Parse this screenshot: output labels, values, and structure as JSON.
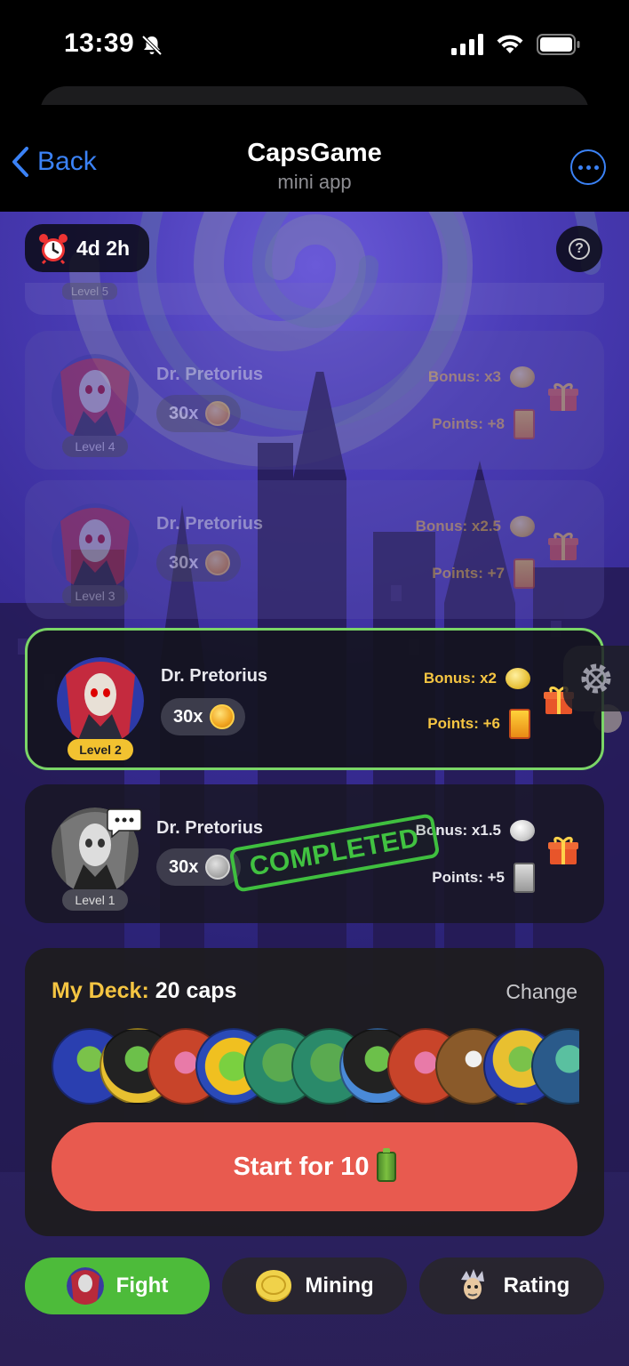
{
  "status": {
    "time": "13:39"
  },
  "nav": {
    "back_label": "Back",
    "title": "CapsGame",
    "subtitle": "mini app"
  },
  "timer": {
    "icon": "alarm-clock-icon",
    "value": "4d 2h"
  },
  "top_strip": {
    "label": "Level 5"
  },
  "bosses": [
    {
      "name": "Dr. Pretorius",
      "multiplier": "30x",
      "level": "Level 4",
      "bonus": "Bonus: x3",
      "points": "Points: +8",
      "state": "locked"
    },
    {
      "name": "Dr. Pretorius",
      "multiplier": "30x",
      "level": "Level 3",
      "bonus": "Bonus: x2.5",
      "points": "Points: +7",
      "state": "locked"
    },
    {
      "name": "Dr. Pretorius",
      "multiplier": "30x",
      "level": "Level 2",
      "bonus": "Bonus: x2",
      "points": "Points: +6",
      "state": "active"
    },
    {
      "name": "Dr. Pretorius",
      "multiplier": "30x",
      "level": "Level 1",
      "bonus": "Bonus: x1.5",
      "points": "Points: +5",
      "state": "completed",
      "stamp": "COMPLETED"
    }
  ],
  "deck": {
    "title_prefix": "My Deck:",
    "title_value": "20 caps",
    "change_label": "Change",
    "start_label": "Start for 10"
  },
  "tabs": [
    {
      "label": "Fight",
      "icon": "villain-avatar-icon",
      "active": true
    },
    {
      "label": "Mining",
      "icon": "gold-coin-icon",
      "active": false
    },
    {
      "label": "Rating",
      "icon": "character-head-icon",
      "active": false
    }
  ],
  "colors": {
    "accent_green": "#4dbb3a",
    "start_red": "#e85a4f",
    "ios_blue": "#3b82f6",
    "gold": "#f5c542"
  }
}
